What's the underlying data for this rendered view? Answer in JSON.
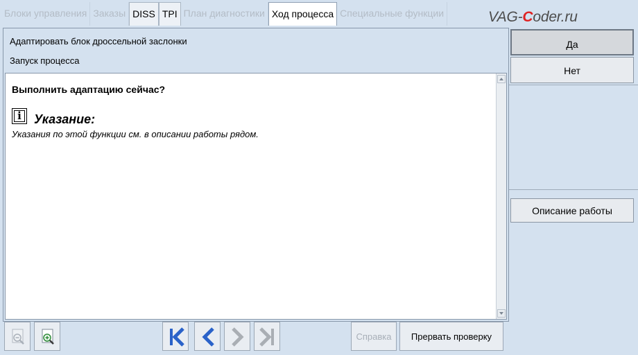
{
  "tabs": [
    {
      "label": "Блоки управления",
      "state": "disabled"
    },
    {
      "label": "Заказы",
      "state": "disabled"
    },
    {
      "label": "DISS",
      "state": "enabled"
    },
    {
      "label": "TPI",
      "state": "enabled"
    },
    {
      "label": "План диагностики",
      "state": "disabled"
    },
    {
      "label": "Ход процесса",
      "state": "active"
    },
    {
      "label": "Специальные функции",
      "state": "disabled"
    }
  ],
  "logo": {
    "part1": "VAG-",
    "part2": "C",
    "part3": "oder.ru"
  },
  "header": {
    "line1": "Адаптировать блок дроссельной заслонки",
    "line2": "Запуск процесса"
  },
  "content": {
    "question": "Выполнить адаптацию сейчас?",
    "info_glyph": "i",
    "note_title": "Указание:",
    "note_text": "Указания по этой функции см. в описании работы рядом."
  },
  "right": {
    "yes_label": "Да",
    "no_label": "Нет",
    "description_label": "Описание работы"
  },
  "toolbar": {
    "help_label": "Справка",
    "abort_label": "Прервать проверку"
  },
  "colors": {
    "background": "#d4e1ef",
    "nav_arrow_active": "#2a62c9",
    "nav_arrow_disabled": "#a9aeb4",
    "logo_accent": "#e02222"
  }
}
